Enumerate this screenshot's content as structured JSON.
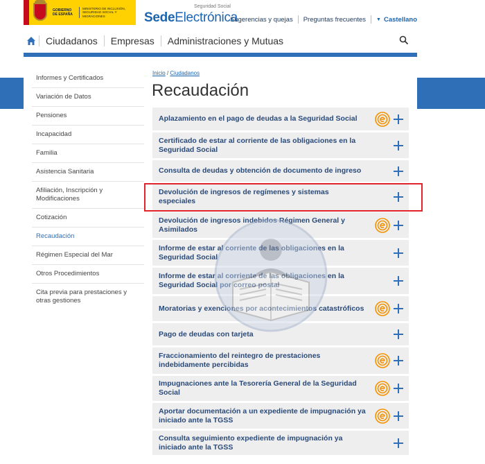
{
  "header": {
    "gov_text": "GOBIERNO DE ESPAÑA",
    "ministry_text": "MINISTERIO DE INCLUSIÓN, SEGURIDAD SOCIAL Y MIGRACIONES",
    "sede_small": "Seguridad Social",
    "sede_bold": "Sede",
    "sede_rest": "Electrónica",
    "links": [
      "Sugerencias y quejas",
      "Preguntas frecuentes"
    ],
    "language": "Castellano"
  },
  "nav": {
    "items": [
      "Ciudadanos",
      "Empresas",
      "Administraciones y Mutuas"
    ]
  },
  "sidebar": {
    "items": [
      {
        "label": "Informes y Certificados"
      },
      {
        "label": "Variación de Datos"
      },
      {
        "label": "Pensiones"
      },
      {
        "label": "Incapacidad"
      },
      {
        "label": "Familia"
      },
      {
        "label": "Asistencia Sanitaria"
      },
      {
        "label": "Afiliación, Inscripción y Modificaciones"
      },
      {
        "label": "Cotización"
      },
      {
        "label": "Recaudación"
      },
      {
        "label": "Régimen Especial del Mar"
      },
      {
        "label": "Otros Procedimientos"
      },
      {
        "label": "Cita previa para prestaciones y otras gestiones"
      }
    ],
    "active": "Recaudación"
  },
  "breadcrumb": {
    "home": "Inicio",
    "separator": "/",
    "section": "Ciudadanos"
  },
  "page_title": "Recaudación",
  "accordion": [
    {
      "label": "Aplazamiento en el pago de deudas a la Seguridad Social",
      "eicon": true
    },
    {
      "label": "Certificado de estar al corriente de las obligaciones en la Seguridad Social",
      "eicon": false
    },
    {
      "label": "Consulta de deudas y obtención de documento de ingreso",
      "eicon": false
    },
    {
      "label": "Devolución de ingresos de regímenes y sistemas especiales",
      "eicon": false
    },
    {
      "label": "Devolución de ingresos indebidos Régimen General y Asimilados",
      "eicon": true
    },
    {
      "label": "Informe de estar al corriente de las obligaciones en la Seguridad Social",
      "eicon": false
    },
    {
      "label": "Informe de estar al corriente de las obligaciones en la Seguridad Social por correo postal",
      "eicon": false
    },
    {
      "label": "Moratorias y exenciones por acontecimientos catastróficos",
      "eicon": true
    },
    {
      "label": "Pago de deudas con tarjeta",
      "eicon": false
    },
    {
      "label": "Fraccionamiento del reintegro de prestaciones indebidamente percibidas",
      "eicon": true
    },
    {
      "label": "Impugnaciones ante la Tesorería General de la Seguridad Social",
      "eicon": true
    },
    {
      "label": "Aportar documentación a un expediente de impugnación ya iniciado ante la TGSS",
      "eicon": true
    },
    {
      "label": "Consulta seguimiento expediente de impugnación ya iniciado ante la TGSS",
      "eicon": false
    }
  ],
  "colors": {
    "brand_blue": "#2f6fb7",
    "highlight_red": "#e0222a",
    "eicon_orange": "#f39200"
  }
}
